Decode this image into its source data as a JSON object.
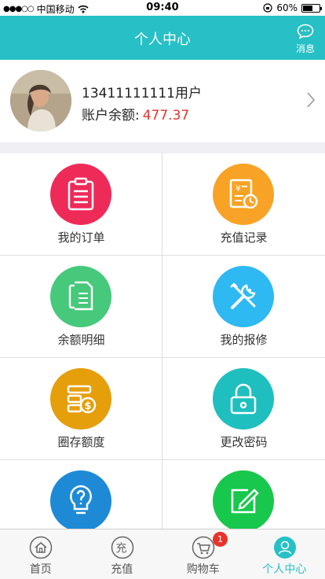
{
  "status_bar": {
    "carrier": "中国移动",
    "time": "09:40",
    "battery": "60%"
  },
  "header": {
    "title": "个人中心",
    "message_label": "消息"
  },
  "profile": {
    "username": "13411111111用户",
    "balance_label": "账户余额:",
    "balance_value": "477.37"
  },
  "menu": {
    "items": [
      {
        "label": "我的订单",
        "icon": "clipboard-icon",
        "color": "#ee2b58"
      },
      {
        "label": "充值记录",
        "icon": "recharge-record-icon",
        "color": "#f8a325"
      },
      {
        "label": "余额明细",
        "icon": "documents-icon",
        "color": "#46c97a"
      },
      {
        "label": "我的报修",
        "icon": "tools-icon",
        "color": "#2eb9f2"
      },
      {
        "label": "圈存额度",
        "icon": "quota-icon",
        "color": "#e59f0a"
      },
      {
        "label": "更改密码",
        "icon": "lock-icon",
        "color": "#1fbfbf"
      },
      {
        "label": "",
        "icon": "lightbulb-icon",
        "color": "#1e8ad6"
      },
      {
        "label": "",
        "icon": "edit-icon",
        "color": "#18c84c"
      }
    ]
  },
  "tabbar": {
    "tabs": [
      {
        "label": "首页",
        "icon": "home-icon"
      },
      {
        "label": "充值",
        "icon": "recharge-icon"
      },
      {
        "label": "购物车",
        "icon": "cart-icon",
        "badge": "1"
      },
      {
        "label": "个人中心",
        "icon": "user-icon"
      }
    ],
    "active_color": "#26c0c6"
  }
}
